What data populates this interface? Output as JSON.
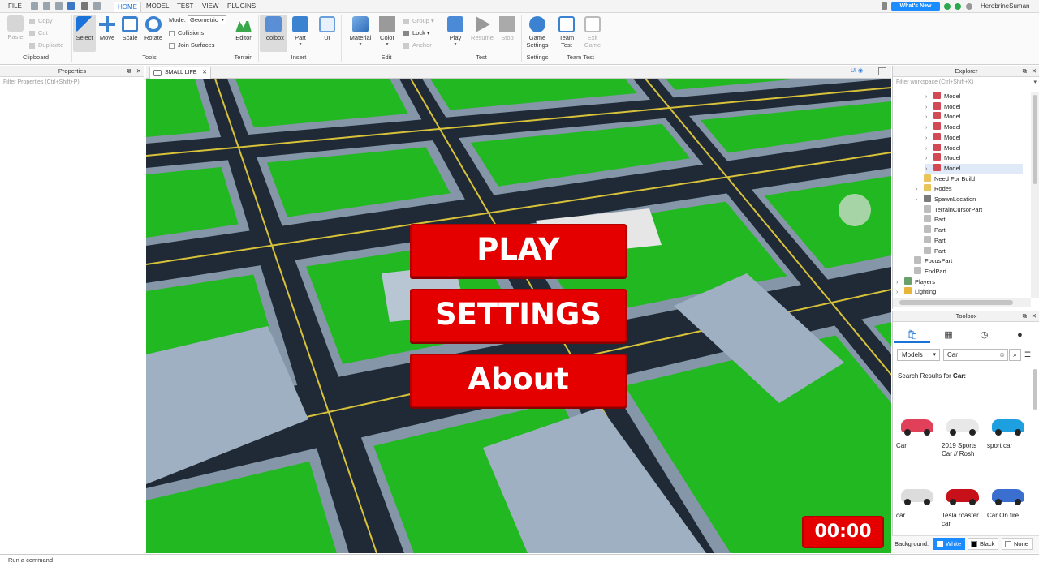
{
  "menubar": {
    "file": "FILE",
    "tabs": [
      "HOME",
      "MODEL",
      "TEST",
      "VIEW",
      "PLUGINS"
    ],
    "active_tab": "HOME",
    "whats_new": "What's New",
    "username": "HerobrineSuman"
  },
  "ribbon": {
    "clipboard": {
      "paste": "Paste",
      "copy": "Copy",
      "cut": "Cut",
      "duplicate": "Duplicate",
      "label": "Clipboard"
    },
    "tools": {
      "select": "Select",
      "move": "Move",
      "scale": "Scale",
      "rotate": "Rotate",
      "mode_label": "Mode:",
      "mode_value": "Geometric",
      "collisions": "Collisions",
      "join_surfaces": "Join Surfaces",
      "label": "Tools"
    },
    "terrain": {
      "editor": "Editor",
      "label": "Terrain"
    },
    "insert": {
      "toolbox": "Toolbox",
      "part": "Part",
      "ui": "UI",
      "label": "Insert"
    },
    "edit": {
      "material": "Material",
      "color": "Color",
      "group": "Group",
      "lock": "Lock",
      "anchor": "Anchor",
      "label": "Edit"
    },
    "test": {
      "play": "Play",
      "resume": "Resume",
      "stop": "Stop",
      "label": "Test"
    },
    "settings": {
      "game_settings_1": "Game",
      "game_settings_2": "Settings",
      "label": "Settings"
    },
    "team_test": {
      "team_1": "Team",
      "team_2": "Test",
      "exit_1": "Exit",
      "exit_2": "Game",
      "label": "Team Test"
    }
  },
  "properties": {
    "title": "Properties",
    "filter_placeholder": "Filter Properties (Ctrl+Shift+P)"
  },
  "doc_tab": {
    "name": "SMALL LIFE",
    "ui_toggle": "UI"
  },
  "game_ui": {
    "play": "PLAY",
    "settings": "SETTINGS",
    "about": "About",
    "timer": "00:00"
  },
  "explorer": {
    "title": "Explorer",
    "filter_placeholder": "Filter workspace (Ctrl+Shift+X)",
    "items": [
      {
        "label": "Model",
        "indent": 3,
        "arrow": true,
        "icon": "model-icon"
      },
      {
        "label": "Model",
        "indent": 3,
        "arrow": true,
        "icon": "model-icon"
      },
      {
        "label": "Model",
        "indent": 3,
        "arrow": true,
        "icon": "model-icon"
      },
      {
        "label": "Model",
        "indent": 3,
        "arrow": true,
        "icon": "model-icon"
      },
      {
        "label": "Model",
        "indent": 3,
        "arrow": true,
        "icon": "model-icon"
      },
      {
        "label": "Model",
        "indent": 3,
        "arrow": true,
        "icon": "model-icon"
      },
      {
        "label": "Model",
        "indent": 3,
        "arrow": true,
        "icon": "model-icon"
      },
      {
        "label": "Model",
        "indent": 3,
        "arrow": true,
        "icon": "model-icon"
      },
      {
        "label": "Need For Build",
        "indent": 2,
        "arrow": false,
        "icon": "folder-icon"
      },
      {
        "label": "Rodes",
        "indent": 2,
        "arrow": true,
        "icon": "folder-icon"
      },
      {
        "label": "SpawnLocation",
        "indent": 2,
        "arrow": true,
        "icon": "spawn-icon"
      },
      {
        "label": "TerrainCursorPart",
        "indent": 2,
        "arrow": false,
        "icon": "part-icon"
      },
      {
        "label": "Part",
        "indent": 2,
        "arrow": false,
        "icon": "part-icon"
      },
      {
        "label": "Part",
        "indent": 2,
        "arrow": false,
        "icon": "part-icon"
      },
      {
        "label": "Part",
        "indent": 2,
        "arrow": false,
        "icon": "part-icon"
      },
      {
        "label": "Part",
        "indent": 2,
        "arrow": false,
        "icon": "part-icon"
      },
      {
        "label": "FocusPart",
        "indent": 1,
        "arrow": false,
        "icon": "part-icon"
      },
      {
        "label": "EndPart",
        "indent": 1,
        "arrow": false,
        "icon": "part-icon"
      },
      {
        "label": "Players",
        "indent": 0,
        "arrow": true,
        "icon": "players-icon"
      },
      {
        "label": "Lighting",
        "indent": 0,
        "arrow": true,
        "icon": "lighting-icon"
      }
    ]
  },
  "toolbox": {
    "title": "Toolbox",
    "category": "Models",
    "search_value": "Car",
    "results_prefix": "Search Results for",
    "results_query": "Car:",
    "assets": [
      {
        "name": "Car",
        "color": "#e0405a"
      },
      {
        "name": "2019 Sports Car // Rosh",
        "color": "#e8e8e8"
      },
      {
        "name": "sport car",
        "color": "#1ea0e0"
      },
      {
        "name": "car",
        "color": "#dcdcdc"
      },
      {
        "name": "Tesla roaster car",
        "color": "#c8101a"
      },
      {
        "name": "Car On fire",
        "color": "#3a6fd0"
      }
    ],
    "background_label": "Background:",
    "bg_options": [
      "White",
      "Black",
      "None"
    ]
  },
  "command_bar": {
    "placeholder": "Run a command"
  }
}
